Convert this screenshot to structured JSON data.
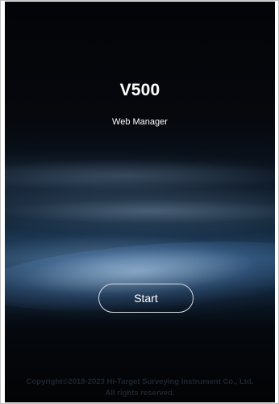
{
  "app": {
    "title": "V500",
    "subtitle": "Web Manager"
  },
  "actions": {
    "start_label": "Start"
  },
  "footer": {
    "line1": "Copyright©2018-2023 Hi-Target Surveying Instrument Co., Ltd.",
    "line2": "All rights reserved."
  },
  "colors": {
    "text": "#ffffff",
    "button_border": "#d8dde3",
    "footer_text": "#1e2631",
    "background_top": "#030407",
    "background_horizon": "#1d3b57"
  }
}
